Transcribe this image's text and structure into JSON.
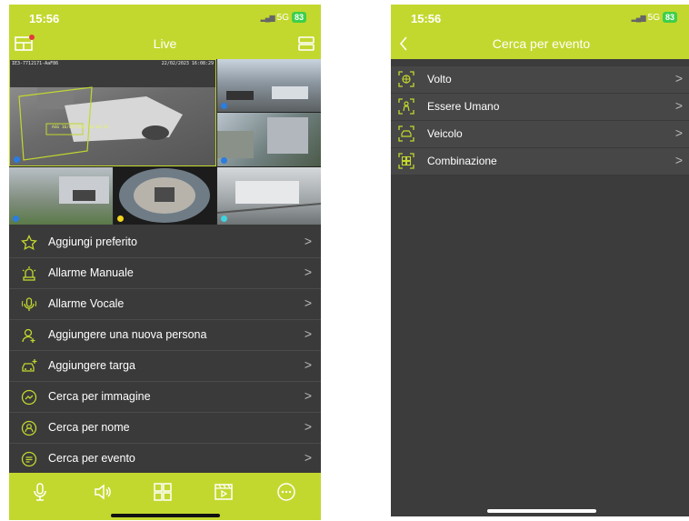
{
  "colors": {
    "accent": "#c3d82e",
    "panel": "#3a3a3a",
    "battery": "#3ecf4a"
  },
  "left": {
    "status": {
      "time": "15:56",
      "network": "5G",
      "battery": "83"
    },
    "nav": {
      "title": "Live",
      "left_icon": "multiview-icon",
      "right_icon": "device-list-icon"
    },
    "cameras": {
      "main_stamp_left": "IE3-7712171-AaF86",
      "main_stamp_right": "22/02/2023 16:08:29",
      "overlay_text": "AGG 16/02/2023 16:08:29"
    },
    "menu": [
      {
        "label": "Aggiungi preferito",
        "icon": "star-icon"
      },
      {
        "label": "Allarme Manuale",
        "icon": "alarm-light-icon"
      },
      {
        "label": "Allarme Vocale",
        "icon": "microphone-icon"
      },
      {
        "label": "Aggiungere una nuova persona",
        "icon": "add-person-icon"
      },
      {
        "label": "Aggiungere targa",
        "icon": "add-car-icon"
      },
      {
        "label": "Cerca per immagine",
        "icon": "image-search-icon"
      },
      {
        "label": "Cerca per nome",
        "icon": "name-search-icon"
      },
      {
        "label": "Cerca per evento",
        "icon": "event-search-icon"
      }
    ],
    "tabs": [
      "microphone-icon",
      "speaker-icon",
      "grid-icon",
      "playback-icon",
      "more-icon"
    ]
  },
  "right": {
    "status": {
      "time": "15:56",
      "network": "5G",
      "battery": "83"
    },
    "nav": {
      "title": "Cerca per evento",
      "back_icon": "back-chevron-icon"
    },
    "menu": [
      {
        "label": "Volto",
        "icon": "face-scan-icon"
      },
      {
        "label": "Essere Umano",
        "icon": "human-scan-icon"
      },
      {
        "label": "Veicolo",
        "icon": "vehicle-scan-icon"
      },
      {
        "label": "Combinazione",
        "icon": "combination-scan-icon"
      }
    ]
  }
}
